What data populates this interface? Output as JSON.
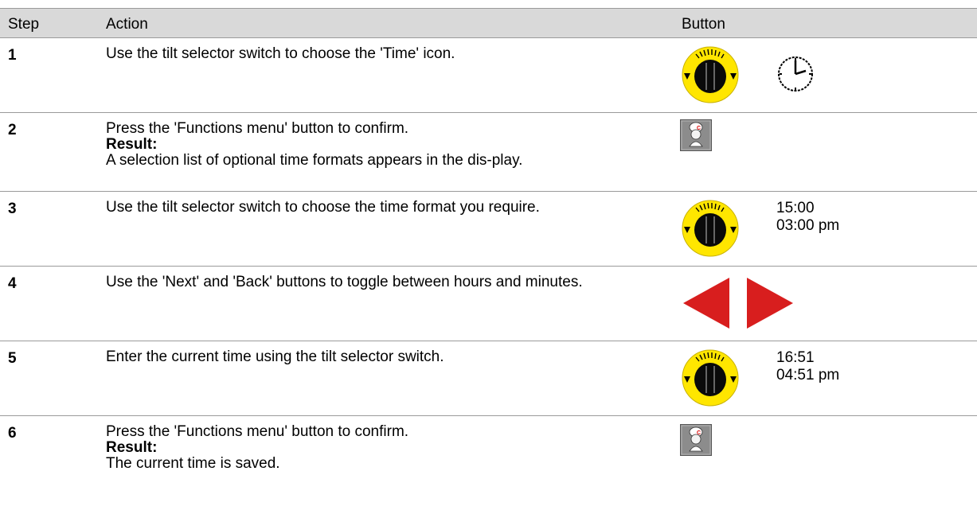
{
  "header": {
    "step": "Step",
    "action": "Action",
    "button": "Button"
  },
  "rows": [
    {
      "step": "1",
      "action": "Use the tilt selector switch to choose the 'Time' icon.",
      "button": "tilt-selector-switch",
      "extra_icon": "clock-icon"
    },
    {
      "step": "2",
      "action": "Press the 'Functions menu' button to confirm.",
      "result_label": "Result:",
      "result": "A selection list of optional time formats appears in the dis-play.",
      "button": "functions-menu-button"
    },
    {
      "step": "3",
      "action": "Use the tilt selector switch to choose the time format you require.",
      "button": "tilt-selector-switch",
      "values": [
        "15:00",
        "03:00 pm"
      ]
    },
    {
      "step": "4",
      "action": "Use the 'Next' and 'Back' buttons to toggle between hours and minutes.",
      "button": "back-next-buttons"
    },
    {
      "step": "5",
      "action": "Enter the current time using the tilt selector switch.",
      "button": "tilt-selector-switch",
      "values": [
        "16:51",
        "04:51 pm"
      ]
    },
    {
      "step": "6",
      "action": "Press the 'Functions menu' button to confirm.",
      "result_label": "Result:",
      "result": "The current time is saved.",
      "button": "functions-menu-button"
    }
  ],
  "colors": {
    "header_bg": "#d9d9d9",
    "knob_yellow": "#ffe600",
    "arrow_red": "#d81e1e"
  }
}
